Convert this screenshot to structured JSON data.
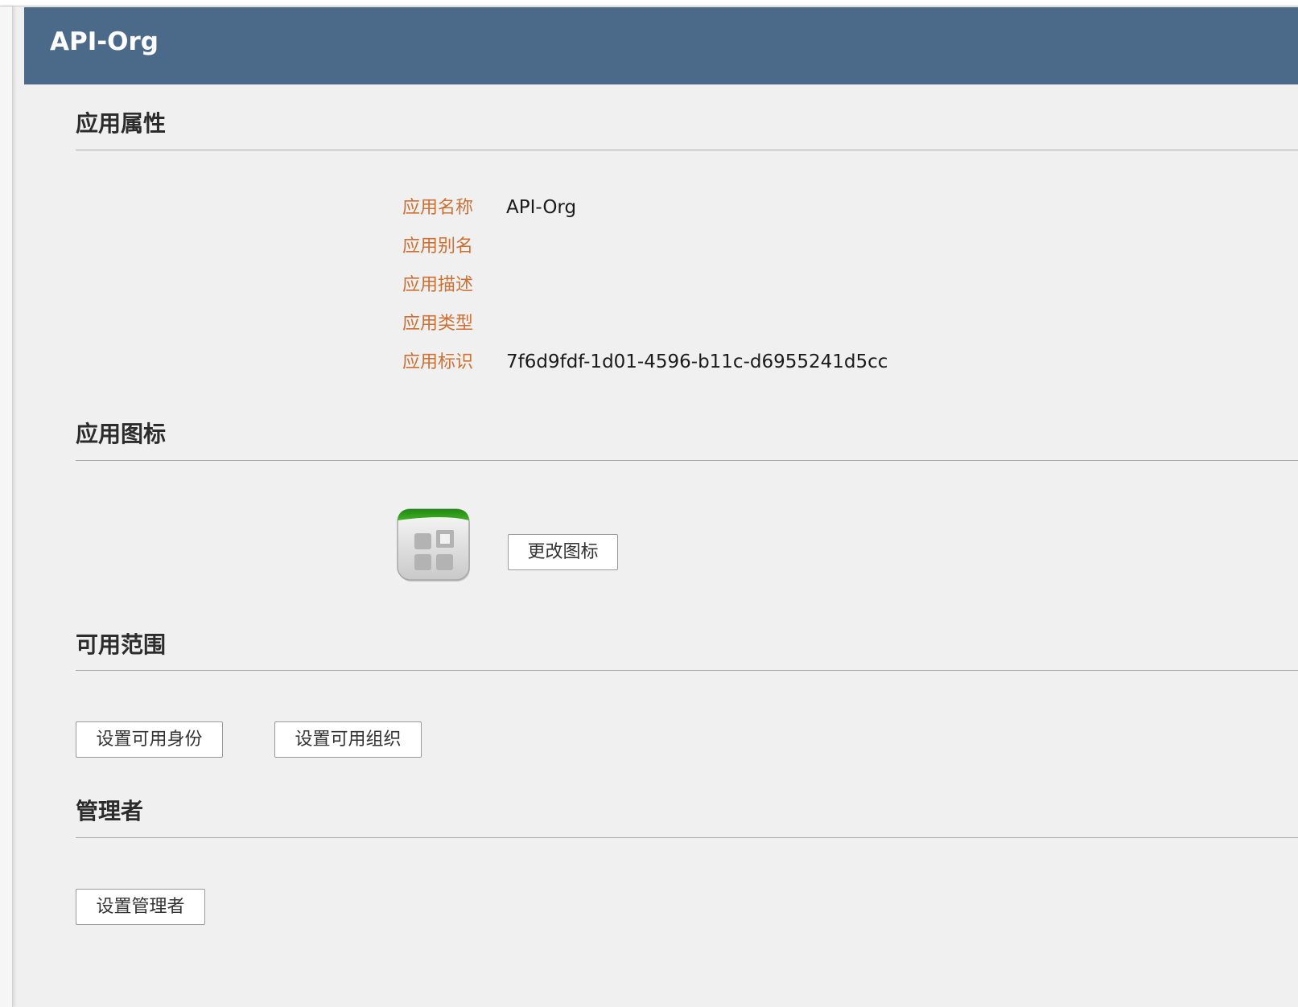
{
  "header": {
    "title": "API-Org"
  },
  "sections": {
    "properties": {
      "title": "应用属性",
      "fields": [
        {
          "label": "应用名称",
          "value": "API-Org"
        },
        {
          "label": "应用别名",
          "value": ""
        },
        {
          "label": "应用描述",
          "value": ""
        },
        {
          "label": "应用类型",
          "value": ""
        },
        {
          "label": "应用标识",
          "value": "7f6d9fdf-1d01-4596-b11c-d6955241d5cc"
        }
      ]
    },
    "icon": {
      "title": "应用图标",
      "icon_name": "app-grid-icon",
      "change_button": "更改图标"
    },
    "scope": {
      "title": "可用范围",
      "identity_button": "设置可用身份",
      "org_button": "设置可用组织"
    },
    "admins": {
      "title": "管理者",
      "set_admin_button": "设置管理者"
    }
  },
  "colors": {
    "header_bg": "#4b6a89",
    "label": "#cf6f32",
    "background": "#f0f0f0",
    "icon_accent": "#3a9a1a"
  }
}
